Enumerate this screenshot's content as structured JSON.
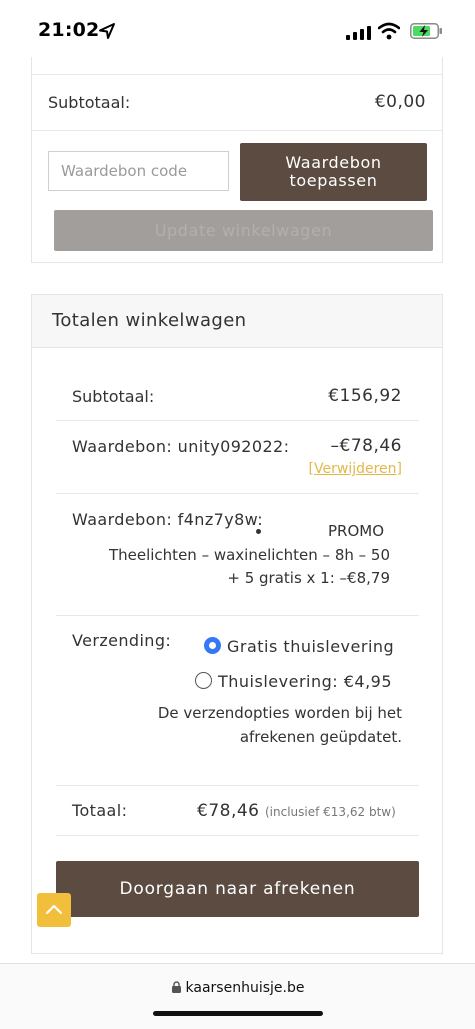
{
  "status_bar": {
    "time": "21:02"
  },
  "cart": {
    "subtotal_label": "Subtotaal:",
    "subtotal_value": "€0,00",
    "coupon_placeholder": "Waardebon code",
    "apply_coupon_label": "Waardebon toepassen",
    "update_cart_label": "Update winkelwagen"
  },
  "totals": {
    "title": "Totalen winkelwagen",
    "subtotal_label": "Subtotaal:",
    "subtotal_value": "€156,92",
    "coupon1_label": "Waardebon: unity092022:",
    "coupon1_value": "–€78,46",
    "coupon1_remove": "[Verwijderen]",
    "coupon2_label": "Waardebon: f4nz7y8w:",
    "promo_tag": "PROMO",
    "promo_line1": "Theelichten – waxinelichten – 8h – 50",
    "promo_line2": "+ 5 gratis x 1: –€8,79",
    "shipping_label": "Verzending:",
    "shipping_options": [
      {
        "label": "Gratis thuislevering",
        "selected": true
      },
      {
        "label": "Thuislevering: €4,95",
        "selected": false
      }
    ],
    "shipping_note_line1": "De verzendopties worden bij het",
    "shipping_note_line2": "afrekenen geüpdatet.",
    "total_label": "Totaal:",
    "total_value": "€78,46",
    "total_tax": "(inclusief €13,62 btw)",
    "checkout_label": "Doorgaan naar afrekenen"
  },
  "browser": {
    "url": "kaarsenhuisje.be"
  },
  "colors": {
    "button_brown": "#5b4b41",
    "link_gold": "#e2b84a",
    "radio_blue": "#3478f6",
    "scroll_top": "#f1bf3c"
  }
}
